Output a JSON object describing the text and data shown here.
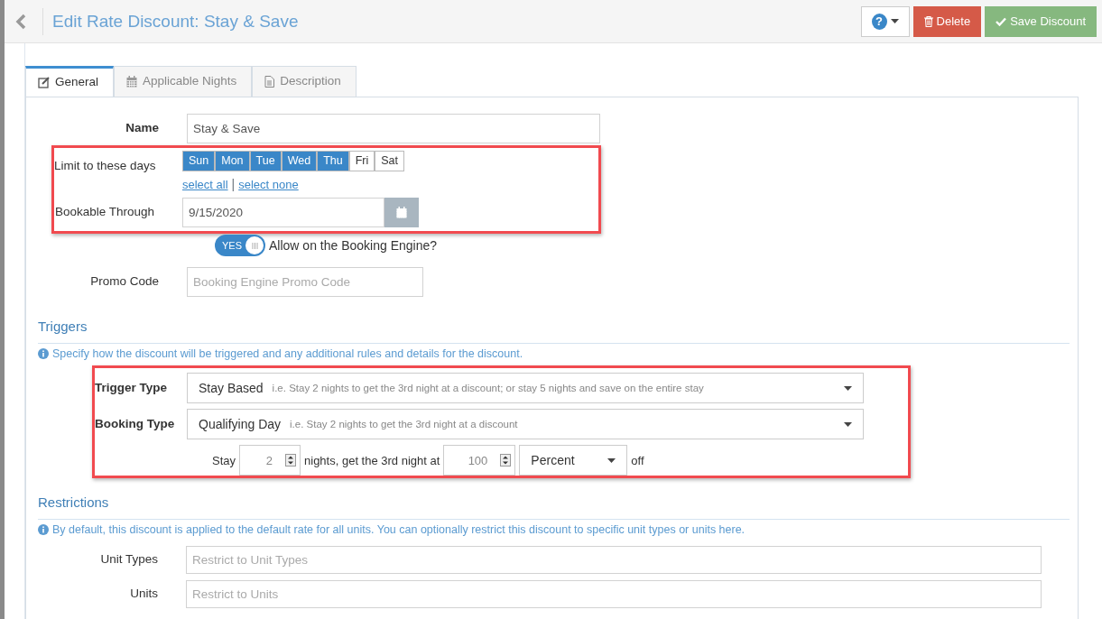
{
  "header": {
    "title": "Edit Rate Discount: Stay & Save",
    "buttons": [
      {
        "kind": "help",
        "label": "?"
      },
      {
        "kind": "delete",
        "label": "Delete"
      },
      {
        "kind": "save",
        "label": "Save Discount"
      }
    ]
  },
  "tabs": [
    {
      "label": "General",
      "selected": true
    },
    {
      "label": "Applicable Nights",
      "selected": false
    },
    {
      "label": "Description",
      "selected": false
    }
  ],
  "name": {
    "label": "Name",
    "value": "Stay & Save"
  },
  "schedule": {
    "highlighted": true,
    "days_label": "Limit to these days",
    "days": [
      {
        "label": "Sun",
        "selected": true
      },
      {
        "label": "Mon",
        "selected": true
      },
      {
        "label": "Tue",
        "selected": true
      },
      {
        "label": "Wed",
        "selected": true
      },
      {
        "label": "Thu",
        "selected": true
      },
      {
        "label": "Fri",
        "selected": false
      },
      {
        "label": "Sat",
        "selected": false
      }
    ],
    "select_all": "select all",
    "separator": "|",
    "select_none": "select none",
    "bookable_label": "Bookable Through",
    "bookable_value": "9/15/2020"
  },
  "booking_engine": {
    "on": true,
    "toggle_label": "YES",
    "label": "Allow on the Booking Engine?"
  },
  "promo": {
    "label": "Promo Code",
    "placeholder": "Booking Engine Promo Code"
  },
  "triggers": {
    "heading": "Triggers",
    "info": "Specify how the discount will be triggered and any additional rules and details for the discount.",
    "highlighted": true,
    "selects": [
      {
        "label": "Trigger Type",
        "value": "Stay Based",
        "hint": "i.e. Stay 2 nights to get the 3rd night at a discount; or stay 5 nights and save on the entire stay"
      },
      {
        "label": "Booking Type",
        "value": "Qualifying Day",
        "hint": "i.e. Stay 2 nights to get the 3rd night at a discount"
      }
    ],
    "rule": {
      "stay": "Stay",
      "nights": "2",
      "middle": "nights, get the 3rd night at",
      "amount": "100",
      "unit": "Percent",
      "off": "off"
    }
  },
  "restrictions": {
    "heading": "Restrictions",
    "info": "By default, this discount is applied to the default rate for all units. You can optionally restrict this discount to specific unit types or units here.",
    "fields": [
      {
        "label": "Unit Types",
        "placeholder": "Restrict to Unit Types"
      },
      {
        "label": "Units",
        "placeholder": "Restrict to Units"
      }
    ]
  }
}
